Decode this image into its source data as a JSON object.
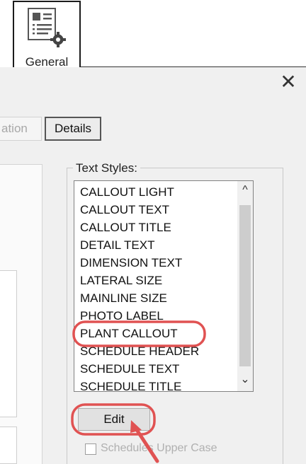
{
  "ribbon": {
    "general_label": "General"
  },
  "dialog": {
    "close_glyph": "✕",
    "tab_partial_label": "ation",
    "tab_details_label": "Details",
    "text_styles": {
      "group_label": "Text Styles:",
      "items": [
        {
          "label": "CALLOUT LIGHT"
        },
        {
          "label": "CALLOUT TEXT"
        },
        {
          "label": "CALLOUT TITLE"
        },
        {
          "label": "DETAIL TEXT"
        },
        {
          "label": "DIMENSION TEXT"
        },
        {
          "label": "LATERAL SIZE"
        },
        {
          "label": "MAINLINE SIZE"
        },
        {
          "label": "PHOTO LABEL"
        },
        {
          "label": "PLANT CALLOUT"
        },
        {
          "label": "SCHEDULE HEADER"
        },
        {
          "label": "SCHEDULE TEXT"
        },
        {
          "label": "SCHEDULE TITLE"
        }
      ],
      "highlighted_item": "PLANT CALLOUT",
      "scroll_up_glyph": "^",
      "scroll_down_glyph": "⌄"
    },
    "edit_button_label": "Edit",
    "checkbox": {
      "label": "Schedules Upper Case",
      "checked": false
    }
  },
  "colors": {
    "annotation_red": "#e05252"
  }
}
